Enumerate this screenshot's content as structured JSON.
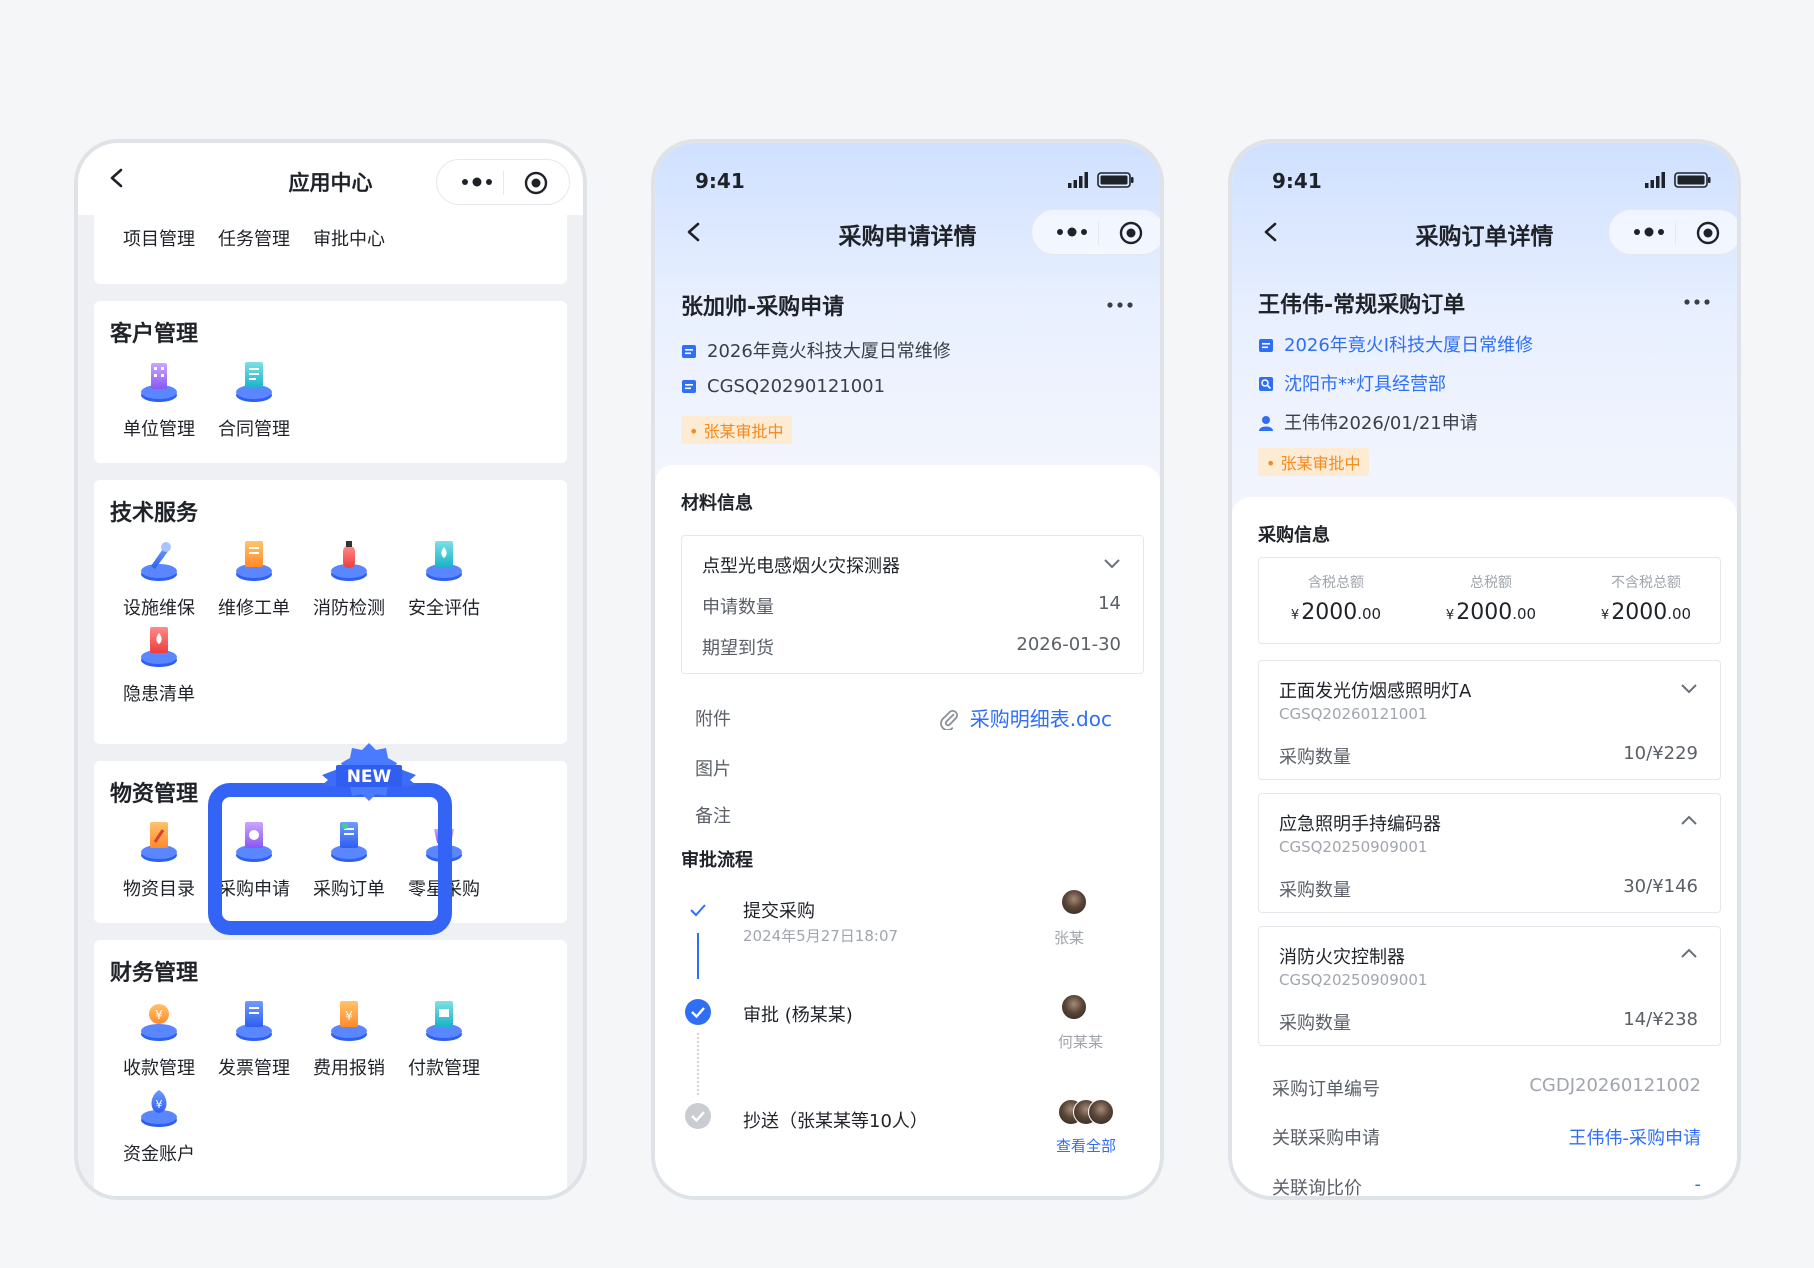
{
  "colors": {
    "primary": "#3464f6",
    "link": "#2f6ff5",
    "warn": "#f58a1f",
    "warn_bg": "#fdebd3"
  },
  "phone1": {
    "nav": {
      "title": "应用中心"
    },
    "top_items": [
      "项目管理",
      "任务管理",
      "审批中心"
    ],
    "sections": [
      {
        "title": "客户管理",
        "items": [
          "单位管理",
          "合同管理"
        ]
      },
      {
        "title": "技术服务",
        "items": [
          "设施维保",
          "维修工单",
          "消防检测",
          "安全评估",
          "隐患清单"
        ]
      },
      {
        "title": "物资管理",
        "items": [
          "物资目录",
          "采购申请",
          "采购订单",
          "零星采购"
        ]
      },
      {
        "title": "财务管理",
        "items": [
          "收款管理",
          "发票管理",
          "费用报销",
          "付款管理",
          "资金账户"
        ]
      }
    ],
    "badge": "NEW"
  },
  "phone2": {
    "status_time": "9:41",
    "nav": {
      "title": "采购申请详情"
    },
    "header": {
      "title": "张加帅-采购申请",
      "project": "2026年竟火科技大厦日常维修",
      "code": "CGSQ20290121001",
      "status": "张某审批中"
    },
    "material": {
      "section_title": "材料信息",
      "item_name": "点型光电感烟火灾探测器",
      "qty_label": "申请数量",
      "qty_value": "14",
      "date_label": "期望到货",
      "date_value": "2026-01-30"
    },
    "attach_label": "附件",
    "attach_file": "采购明细表.doc",
    "image_label": "图片",
    "note_label": "备注",
    "flow": {
      "section_title": "审批流程",
      "steps": [
        {
          "title": "提交采购",
          "time": "2024年5月27日18:07",
          "person": "张某"
        },
        {
          "title": "审批 (杨某某)",
          "person": "何某某"
        },
        {
          "title": "抄送（张某某等10人）",
          "link": "查看全部"
        }
      ]
    }
  },
  "phone3": {
    "status_time": "9:41",
    "nav": {
      "title": "采购订单详情"
    },
    "header": {
      "title": "王伟伟-常规采购订单",
      "project": "2026年竟火I科技大厦日常维修",
      "supplier": "沈阳市**灯具经营部",
      "applicant": "王伟伟2026/01/21申请",
      "status": "张某审批中"
    },
    "purchase": {
      "section_title": "采购信息",
      "totals": [
        {
          "label": "含税总额",
          "currency": "¥",
          "int": "2000",
          "dec": ".00"
        },
        {
          "label": "总税额",
          "currency": "¥",
          "int": "2000",
          "dec": ".00"
        },
        {
          "label": "不含税总额",
          "currency": "¥",
          "int": "2000",
          "dec": ".00"
        }
      ],
      "items": [
        {
          "name": "正面发光仿烟感照明灯A",
          "code": "CGSQ20260121001",
          "qty_label": "采购数量",
          "qty": "10/¥229"
        },
        {
          "name": "应急照明手持编码器",
          "code": "CGSQ20250909001",
          "qty_label": "采购数量",
          "qty": "30/¥146"
        },
        {
          "name": "消防火灾控制器",
          "code": "CGSQ20250909001",
          "qty_label": "采购数量",
          "qty": "14/¥238"
        }
      ]
    },
    "order_no_label": "采购订单编号",
    "order_no": "CGDJ20260121002",
    "rel_apply_label": "关联采购申请",
    "rel_apply": "王伟伟-采购申请",
    "rel_compare_label": "关联询比价",
    "rel_compare": "-"
  }
}
